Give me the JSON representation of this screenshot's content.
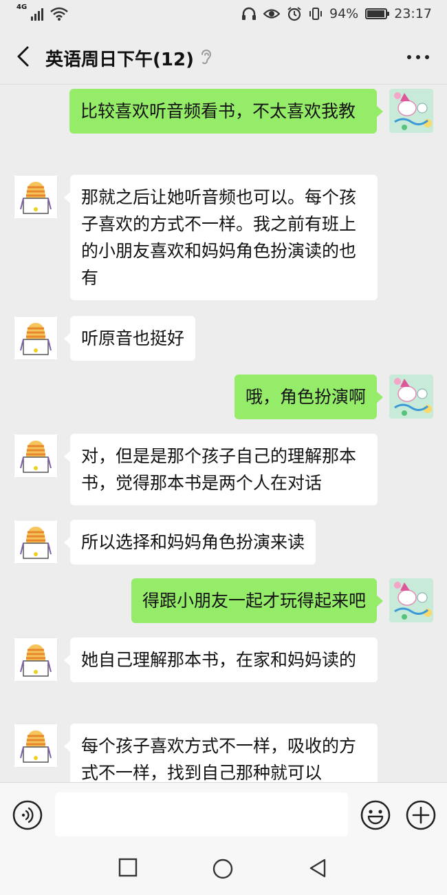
{
  "status_bar": {
    "network": "4G",
    "battery_percent": "94%",
    "battery_level": 0.94,
    "time": "23:17",
    "icons": [
      "signal-icon",
      "wifi-icon",
      "headphones-icon",
      "eye-icon",
      "alarm-icon",
      "vibrate-icon",
      "battery-icon"
    ]
  },
  "header": {
    "title": "英语周日下午(12)",
    "icons": [
      "back-chevron-icon",
      "ear-icon",
      "more-dots-icon"
    ]
  },
  "messages": [
    {
      "from": "self",
      "text": "比较喜欢听音频看书，不太喜欢我教"
    },
    {
      "from": "other",
      "text": "那就之后让她听音频也可以。每个孩子喜欢的方式不一样。我之前有班上的小朋友喜欢和妈妈角色扮演读的也有"
    },
    {
      "from": "other",
      "text": "听原音也挺好"
    },
    {
      "from": "self",
      "text": "哦，角色扮演啊"
    },
    {
      "from": "other",
      "text": "对，但是是那个孩子自己的理解那本书，觉得那本书是两个人在对话"
    },
    {
      "from": "other",
      "text": "所以选择和妈妈角色扮演来读"
    },
    {
      "from": "self",
      "text": "得跟小朋友一起才玩得起来吧"
    },
    {
      "from": "other",
      "text": "她自己理解那本书，在家和妈妈读的"
    },
    {
      "from": "other",
      "text": "每个孩子喜欢方式不一样，吸收的方式不一样，找到自己那种就可以"
    }
  ],
  "input_bar": {
    "value": "",
    "placeholder": "",
    "icons": [
      "voice-icon",
      "emoji-icon",
      "plus-icon"
    ]
  },
  "system_nav": {
    "icons": [
      "recent-apps-icon",
      "home-icon",
      "back-triangle-icon"
    ]
  },
  "colors": {
    "background": "#ededed",
    "self_bubble": "#95ec69",
    "other_bubble": "#ffffff"
  }
}
